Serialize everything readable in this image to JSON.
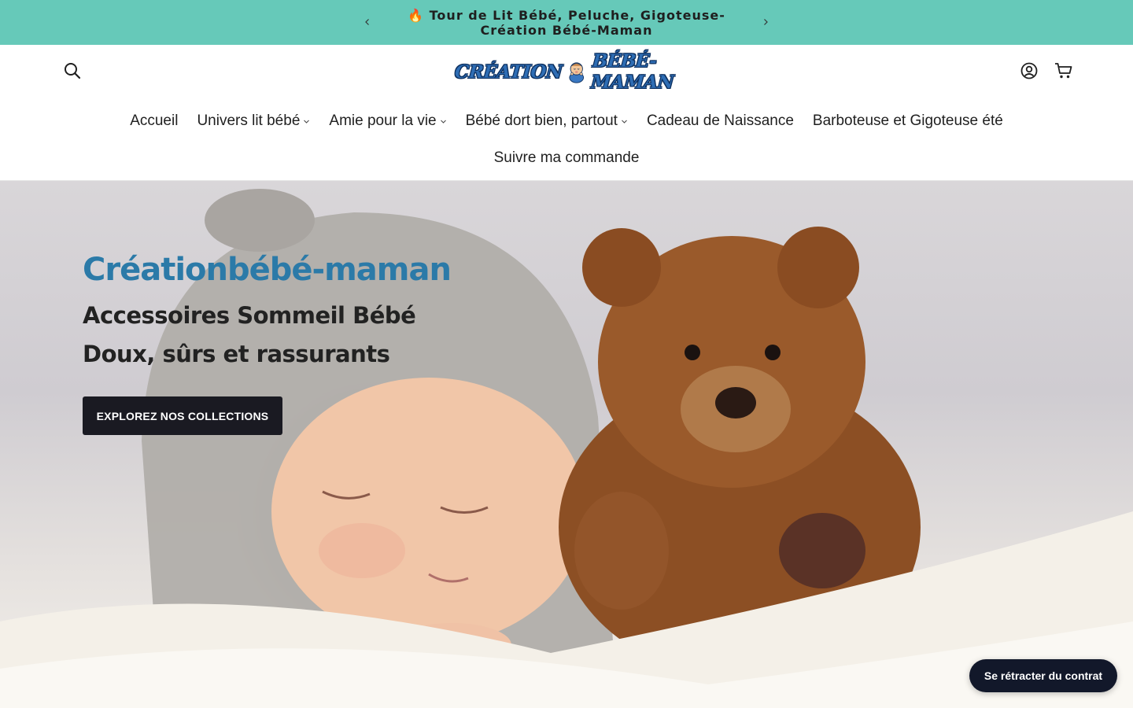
{
  "announcement": {
    "icon": "fire-icon",
    "emoji": "🔥",
    "text": "Tour de Lit Bébé, Peluche, Gigoteuse-Création Bébé-Maman",
    "background": "#66c9b9"
  },
  "header": {
    "logo": {
      "left_word": "CRÉATION",
      "right_word": "BÉBÉ-MAMAN"
    },
    "nav": {
      "row1": [
        {
          "label": "Accueil",
          "dropdown": false
        },
        {
          "label": "Univers lit bébé",
          "dropdown": true
        },
        {
          "label": "Amie pour la vie",
          "dropdown": true
        },
        {
          "label": "Bébé dort bien, partout",
          "dropdown": true
        },
        {
          "label": "Cadeau de Naissance",
          "dropdown": false
        },
        {
          "label": "Barboteuse et Gigoteuse été",
          "dropdown": false
        }
      ],
      "row2": [
        {
          "label": "Suivre ma commande",
          "dropdown": false
        }
      ]
    }
  },
  "hero": {
    "brand": "Créationbébé-maman",
    "line1": "Accessoires Sommeil Bébé",
    "line2": "Doux, sûrs et rassurants",
    "cta_label": "EXPLOREZ NOS COLLECTIONS",
    "brand_color": "#2b7aa8"
  },
  "floating_button": {
    "label": "Se rétracter du contrat"
  }
}
